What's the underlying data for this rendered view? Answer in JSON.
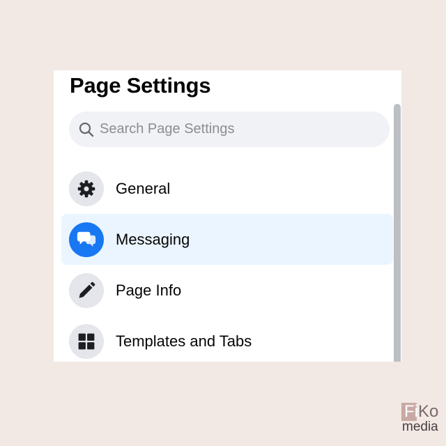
{
  "panel": {
    "title": "Page Settings",
    "search": {
      "placeholder": "Search Page Settings",
      "value": "",
      "icon": "search-icon"
    },
    "menu": [
      {
        "label": "General",
        "icon": "gear-icon",
        "active": false
      },
      {
        "label": "Messaging",
        "icon": "chat-bubbles-icon",
        "active": true
      },
      {
        "label": "Page Info",
        "icon": "pencil-icon",
        "active": false
      },
      {
        "label": "Templates and Tabs",
        "icon": "grid-icon",
        "active": false
      }
    ]
  },
  "watermark": {
    "brand_part1": "Fi",
    "brand_part2": "Ko",
    "brand_part3": "media"
  },
  "colors": {
    "background": "#f2e8e4",
    "accent": "#1877f2",
    "active_row": "#ebf5ff",
    "icon_circle": "#e4e6eb",
    "search_bg": "#f0f2f5",
    "text": "#050505",
    "placeholder": "#8a8d91",
    "scrollbar": "#bcc0c4"
  }
}
